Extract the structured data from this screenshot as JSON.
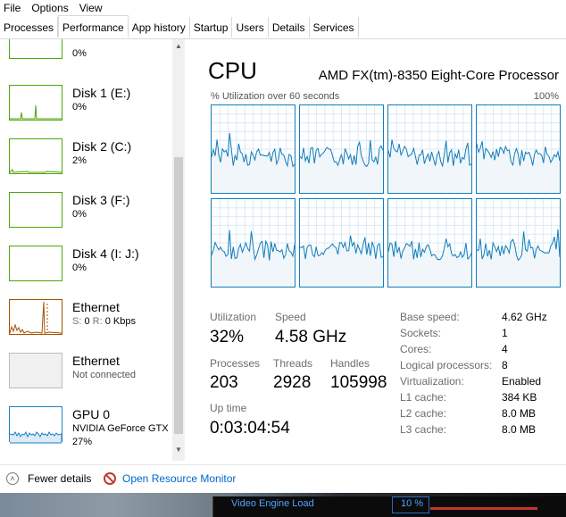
{
  "menu": [
    "File",
    "Options",
    "View"
  ],
  "tabs": [
    "Processes",
    "Performance",
    "App history",
    "Startup",
    "Users",
    "Details",
    "Services"
  ],
  "active_tab": "Performance",
  "sidebar": {
    "items": [
      {
        "title": "",
        "sub": "0%",
        "color": "#4da60c"
      },
      {
        "title": "Disk 1 (E:)",
        "sub": "0%",
        "color": "#4da60c"
      },
      {
        "title": "Disk 2 (C:)",
        "sub": "2%",
        "color": "#4da60c"
      },
      {
        "title": "Disk 3 (F:)",
        "sub": "0%",
        "color": "#4da60c"
      },
      {
        "title": "Disk 4 (I: J:)",
        "sub": "0%",
        "color": "#4da60c"
      },
      {
        "title": "Ethernet",
        "send_label": "S:",
        "send": "0",
        "recv_label": "R:",
        "recv": "0 Kbps",
        "color": "#a74f01"
      },
      {
        "title": "Ethernet",
        "sub": "Not connected",
        "color": "#bcbcbc"
      },
      {
        "title": "GPU 0",
        "sub": "NVIDIA GeForce GTX",
        "sub2": "27%",
        "color": "#1b80c4"
      }
    ]
  },
  "panel": {
    "title": "CPU",
    "model": "AMD FX(tm)-8350 Eight-Core Processor",
    "graph_caption": "% Utilization over 60 seconds",
    "graph_max": "100%",
    "core_count": 8,
    "line_color": "#117dbb",
    "stats": {
      "utilization_label": "Utilization",
      "utilization": "32%",
      "speed_label": "Speed",
      "speed": "4.58 GHz",
      "processes_label": "Processes",
      "processes": "203",
      "threads_label": "Threads",
      "threads": "2928",
      "handles_label": "Handles",
      "handles": "105998",
      "uptime_label": "Up time",
      "uptime": "0:03:04:54"
    },
    "specs": [
      {
        "k": "Base speed:",
        "v": "4.62 GHz"
      },
      {
        "k": "Sockets:",
        "v": "1"
      },
      {
        "k": "Cores:",
        "v": "4"
      },
      {
        "k": "Logical processors:",
        "v": "8"
      },
      {
        "k": "Virtualization:",
        "v": "Enabled"
      },
      {
        "k": "L1 cache:",
        "v": "384 KB"
      },
      {
        "k": "L2 cache:",
        "v": "8.0 MB"
      },
      {
        "k": "L3 cache:",
        "v": "8.0 MB"
      }
    ]
  },
  "footer": {
    "fewer_details": "Fewer details",
    "open_resource_monitor": "Open Resource Monitor"
  },
  "background_app": {
    "label": "Video Engine Load",
    "value": "10 %"
  }
}
